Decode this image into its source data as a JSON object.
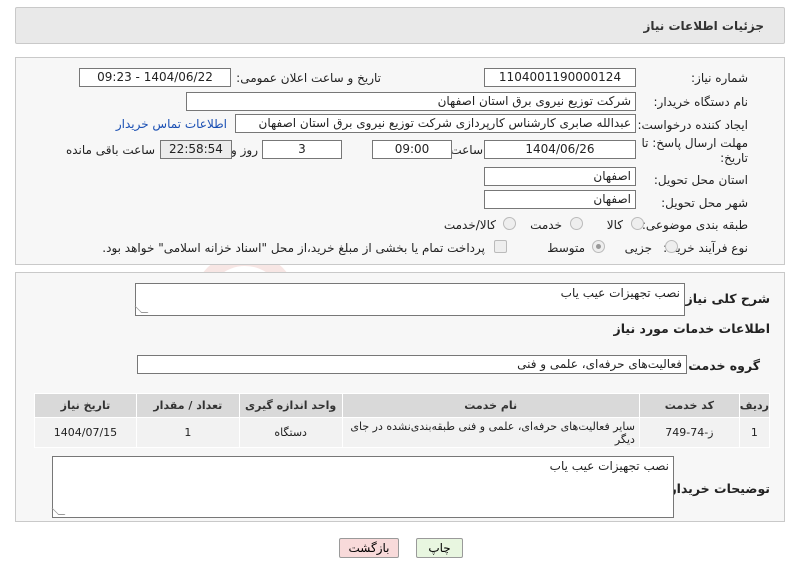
{
  "header": {
    "title": "جزئیات اطلاعات نیاز"
  },
  "form": {
    "need_number_label": "شماره نیاز:",
    "need_number": "1104001190000124",
    "announce_label": "تاریخ و ساعت اعلان عمومی:",
    "announce_value": "1404/06/22 - 09:23",
    "buyer_org_label": "نام دستگاه خریدار:",
    "buyer_org": "شرکت توزیع نیروی برق استان اصفهان",
    "creator_label": "ایجاد کننده درخواست:",
    "creator": "عبدالله صابری کارشناس کارپردازی شرکت توزیع نیروی برق استان اصفهان",
    "contact_link": "اطلاعات تماس خریدار",
    "deadline_label_1": "مهلت ارسال پاسخ: تا",
    "deadline_label_2": "تاریخ:",
    "deadline_date": "1404/06/26",
    "time_label": "ساعت",
    "deadline_time": "09:00",
    "days_value": "3",
    "days_label": "روز و",
    "remaining_time": "22:58:54",
    "remaining_label": "ساعت باقی مانده",
    "province_label": "استان محل تحویل:",
    "province": "اصفهان",
    "city_label": "شهر محل تحویل:",
    "city": "اصفهان",
    "category_label": "طبقه بندی موضوعی:",
    "category_options": [
      "کالا",
      "خدمت",
      "کالا/خدمت"
    ],
    "process_label": "نوع فرآیند خرید :",
    "process_options": [
      "جزیی",
      "متوسط"
    ],
    "payment_note": "پرداخت تمام یا بخشی از مبلغ خرید،از محل \"اسناد خزانه اسلامی\" خواهد بود."
  },
  "services": {
    "summary_label": "شرح کلی نیاز:",
    "summary": "نصب تجهیزات عیب یاب",
    "section_title": "اطلاعات خدمات مورد نیاز",
    "group_label": "گروه خدمت:",
    "group_value": "فعالیت‌های حرفه‌ای، علمی و فنی",
    "table_headers": [
      "ردیف",
      "کد خدمت",
      "نام خدمت",
      "واحد اندازه گیری",
      "تعداد / مقدار",
      "تاریخ نیاز"
    ],
    "rows": [
      {
        "row": "1",
        "code": "ز-74-749",
        "name": "سایر فعالیت‌های حرفه‌ای، علمی و فنی طبقه‌بندی‌نشده در جای دیگر",
        "unit": "دستگاه",
        "qty": "1",
        "date": "1404/07/15"
      }
    ],
    "buyer_notes_label": "توضیحات خریدار:",
    "buyer_notes": "نصب تجهیزات عیب یاب"
  },
  "actions": {
    "print": "چاپ",
    "back": "بازگشت"
  },
  "watermark": "AriaTender.neT",
  "colors": {
    "link": "#1a4fb3",
    "back_button": "#f8dada",
    "print_button": "#e8f6e0"
  }
}
